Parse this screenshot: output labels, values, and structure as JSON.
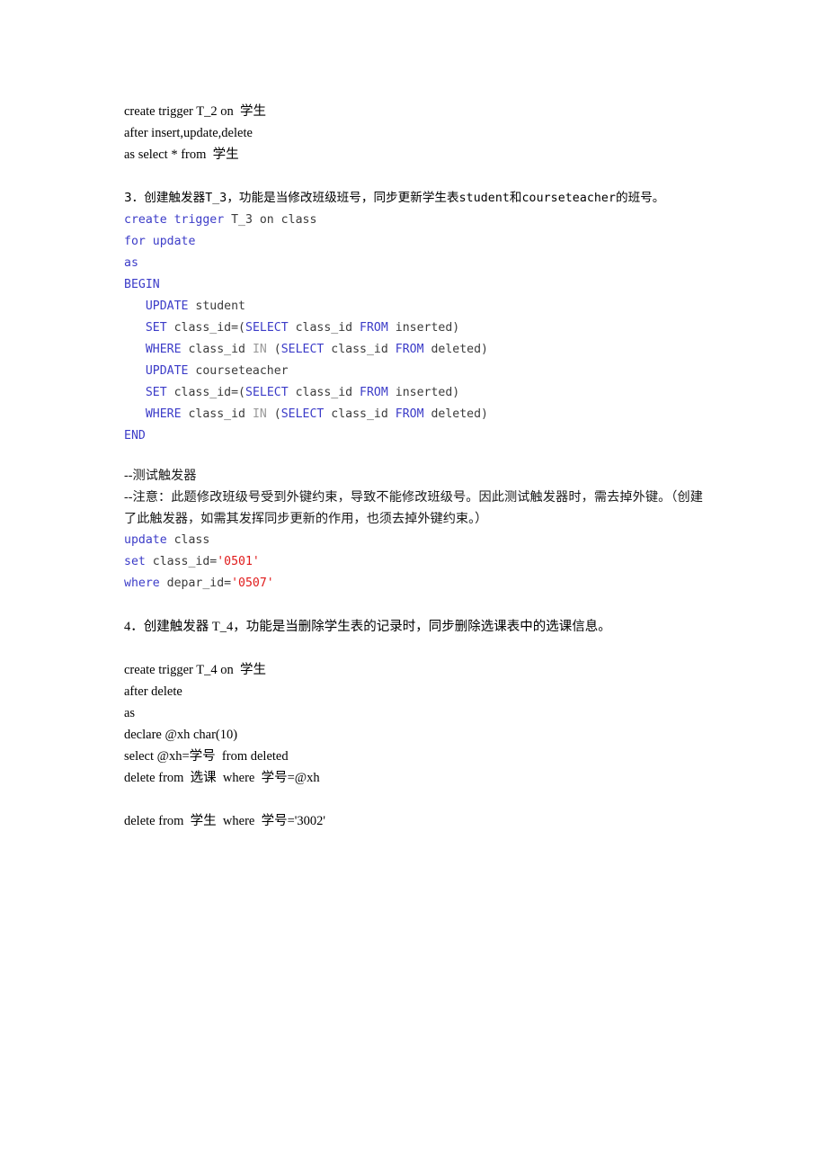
{
  "document": {
    "background_color": "#ffffff",
    "text_color": "#000000",
    "keyword_color": "#3c3cc8",
    "identifier_color": "#3b3b3b",
    "string_color": "#e01b1b",
    "dim_color": "#9a9a9a"
  },
  "trigger_t2": {
    "line1": "create trigger T_2 on  学生",
    "line2": "after insert,update,delete",
    "line3": "as select * from  学生"
  },
  "item3": {
    "prefix": "3．创建触发器",
    "name": "T_3",
    "mid": "，功能是当修改班级班号，同步更新学生表",
    "table1": "student",
    "conj": "和",
    "table2": "courseteacher",
    "suffix": "的班号。"
  },
  "code_t3": {
    "lines": [
      [
        {
          "t": "create trigger",
          "c": "kw"
        },
        {
          "t": " ",
          "c": "pun"
        },
        {
          "t": "T_3 on class",
          "c": "id"
        }
      ],
      [
        {
          "t": "for update",
          "c": "kw"
        }
      ],
      [
        {
          "t": "as",
          "c": "kw"
        }
      ],
      [
        {
          "t": "BEGIN",
          "c": "kw"
        }
      ],
      [
        {
          "t": "   ",
          "c": "pun"
        },
        {
          "t": "UPDATE",
          "c": "kw"
        },
        {
          "t": " student",
          "c": "id"
        }
      ],
      [
        {
          "t": "   ",
          "c": "pun"
        },
        {
          "t": "SET",
          "c": "kw"
        },
        {
          "t": " class_id=(",
          "c": "id"
        },
        {
          "t": "SELECT",
          "c": "kw"
        },
        {
          "t": " class_id ",
          "c": "id"
        },
        {
          "t": "FROM",
          "c": "kw"
        },
        {
          "t": " inserted)",
          "c": "id"
        }
      ],
      [
        {
          "t": "   ",
          "c": "pun"
        },
        {
          "t": "WHERE",
          "c": "kw"
        },
        {
          "t": " class_id ",
          "c": "id"
        },
        {
          "t": "IN",
          "c": "dim"
        },
        {
          "t": " (",
          "c": "id"
        },
        {
          "t": "SELECT",
          "c": "kw"
        },
        {
          "t": " class_id ",
          "c": "id"
        },
        {
          "t": "FROM",
          "c": "kw"
        },
        {
          "t": " deleted)",
          "c": "id"
        }
      ],
      [
        {
          "t": "   ",
          "c": "pun"
        },
        {
          "t": "UPDATE",
          "c": "kw"
        },
        {
          "t": " courseteacher",
          "c": "id"
        }
      ],
      [
        {
          "t": "   ",
          "c": "pun"
        },
        {
          "t": "SET",
          "c": "kw"
        },
        {
          "t": " class_id=(",
          "c": "id"
        },
        {
          "t": "SELECT",
          "c": "kw"
        },
        {
          "t": " class_id ",
          "c": "id"
        },
        {
          "t": "FROM",
          "c": "kw"
        },
        {
          "t": " inserted)",
          "c": "id"
        }
      ],
      [
        {
          "t": "   ",
          "c": "pun"
        },
        {
          "t": "WHERE",
          "c": "kw"
        },
        {
          "t": " class_id ",
          "c": "id"
        },
        {
          "t": "IN",
          "c": "dim"
        },
        {
          "t": " (",
          "c": "id"
        },
        {
          "t": "SELECT",
          "c": "kw"
        },
        {
          "t": " class_id ",
          "c": "id"
        },
        {
          "t": "FROM",
          "c": "kw"
        },
        {
          "t": " deleted)",
          "c": "id"
        }
      ],
      [
        {
          "t": "END",
          "c": "kw"
        }
      ]
    ]
  },
  "note": {
    "line1": "--测试触发器",
    "line2": "--注意：此题修改班级号受到外键约束，导致不能修改班级号。因此测试触发器时，需去掉外键。（创建了此触发器，如需其发挥同步更新的作用，也须去掉外键约束。）"
  },
  "code_test": {
    "lines": [
      [
        {
          "t": "update",
          "c": "kw"
        },
        {
          "t": " class",
          "c": "id"
        }
      ],
      [
        {
          "t": "set",
          "c": "kw"
        },
        {
          "t": " class_id=",
          "c": "id"
        },
        {
          "t": "'0501'",
          "c": "str"
        }
      ],
      [
        {
          "t": "where",
          "c": "kw"
        },
        {
          "t": " depar_id=",
          "c": "id"
        },
        {
          "t": "'0507'",
          "c": "str"
        }
      ]
    ]
  },
  "item4": {
    "text": "4．创建触发器 T_4，功能是当删除学生表的记录时，同步删除选课表中的选课信息。"
  },
  "trigger_t4": {
    "line1": "create trigger T_4 on  学生",
    "line2": "after delete",
    "line3": "as",
    "line4": "declare @xh char(10)",
    "line5": "select @xh=学号  from deleted",
    "line6": "delete from  选课  where  学号=@xh",
    "line7": "delete from  学生  where  学号='3002'"
  }
}
